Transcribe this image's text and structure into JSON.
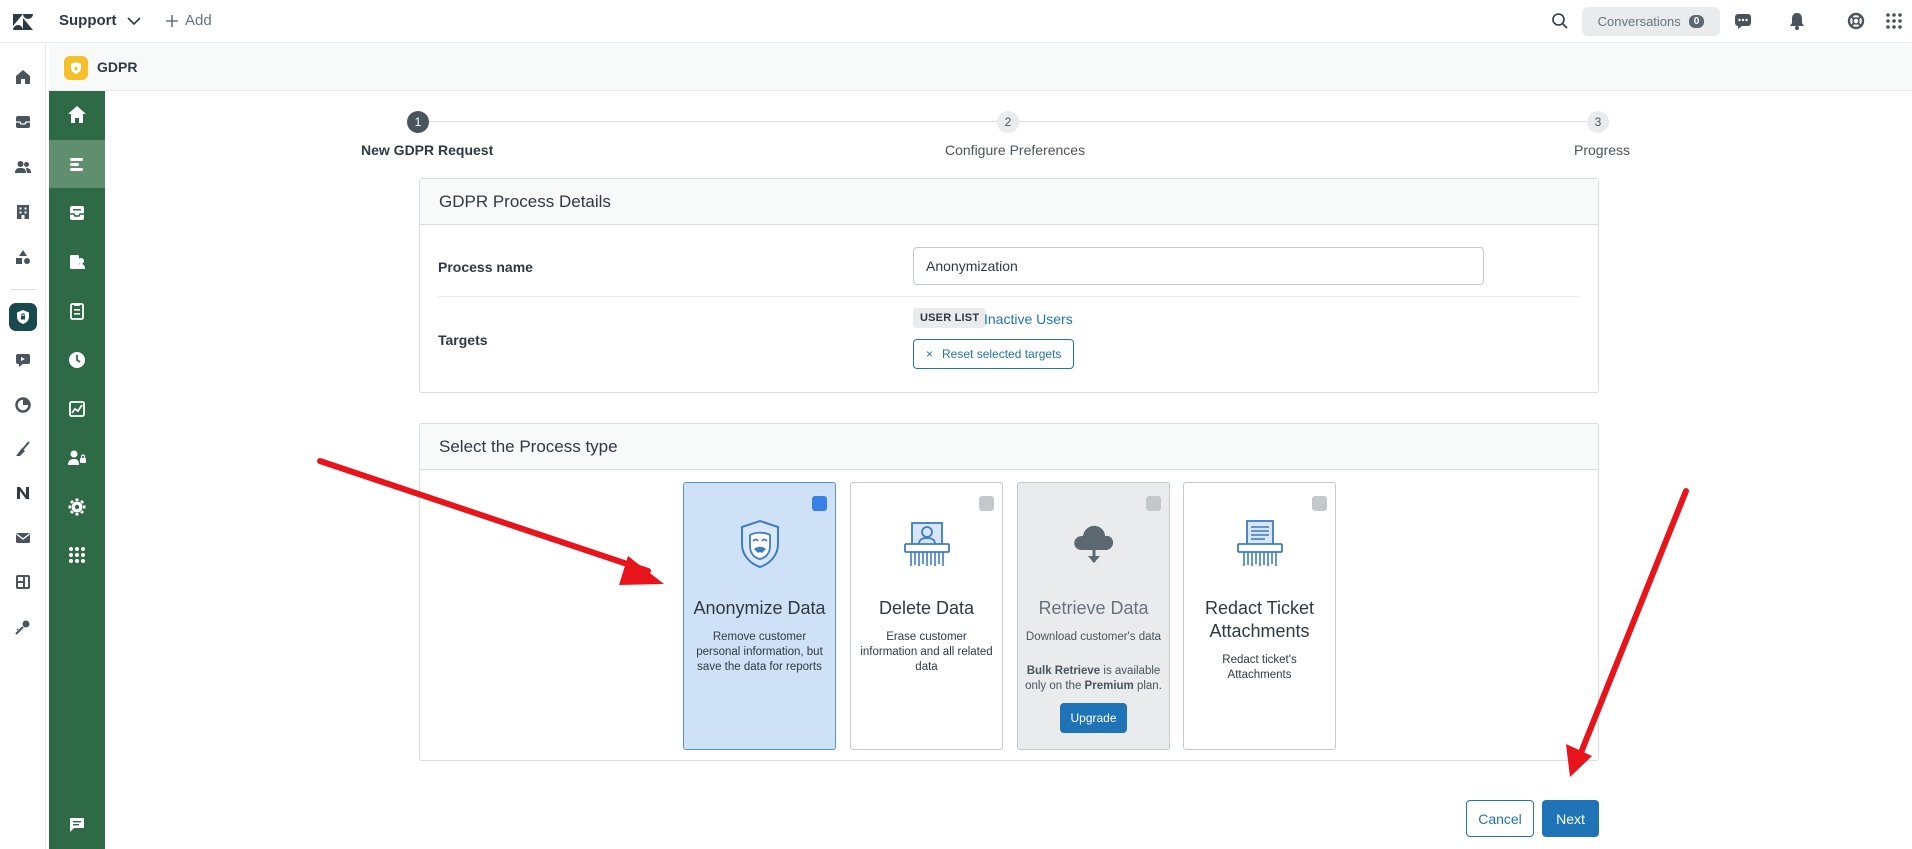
{
  "topbar": {
    "product_label": "Support",
    "add_label": "Add",
    "conversations_label": "Conversations",
    "conversations_count": "0"
  },
  "app": {
    "title": "GDPR"
  },
  "stepper": {
    "steps": [
      {
        "number": "1",
        "label": "New GDPR Request"
      },
      {
        "number": "2",
        "label": "Configure Preferences"
      },
      {
        "number": "3",
        "label": "Progress"
      }
    ]
  },
  "details": {
    "heading": "GDPR Process Details",
    "process_name_label": "Process name",
    "process_name_value": "Anonymization",
    "targets_label": "Targets",
    "target_tag": "USER LIST",
    "target_link": "Inactive Users",
    "reset_label": "Reset selected targets",
    "reset_icon": "×"
  },
  "process_type": {
    "heading": "Select the Process type",
    "cards": [
      {
        "title": "Anonymize Data",
        "desc": "Remove customer personal information, but save the data for reports"
      },
      {
        "title": "Delete Data",
        "desc": "Erase customer information and all related data"
      },
      {
        "title": "Retrieve Data",
        "desc": "Download customer's data",
        "note_bold1": "Bulk Retrieve",
        "note_mid": " is available only on the ",
        "note_bold2": "Premium",
        "note_end": " plan.",
        "button": "Upgrade"
      },
      {
        "title": "Redact Ticket Attachments",
        "desc": "Redact ticket's Attachments"
      }
    ]
  },
  "footer": {
    "cancel_label": "Cancel",
    "next_label": "Next"
  },
  "colors": {
    "brand_green": "#2d6a45",
    "primary_blue": "#1f73b7",
    "selected_card": "#cfe1f7",
    "annotation_arrow": "#e8141c"
  }
}
